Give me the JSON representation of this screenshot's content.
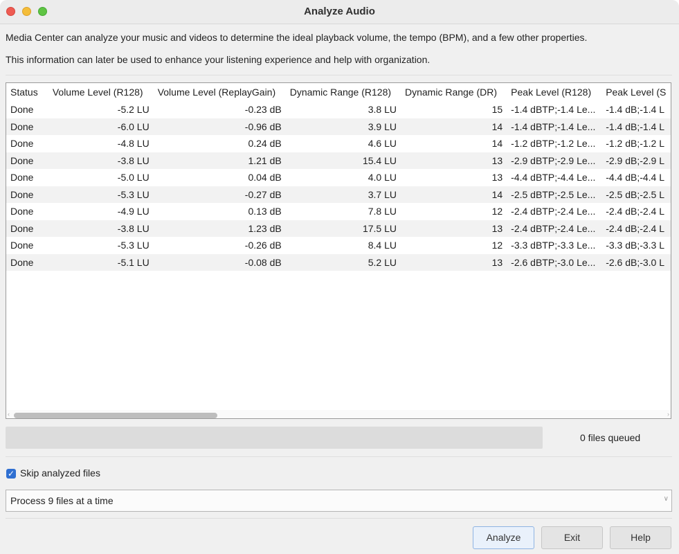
{
  "window": {
    "title": "Analyze Audio"
  },
  "description": {
    "line1": "Media Center can analyze your music and videos to determine the ideal playback volume, the tempo (BPM), and a few other properties.",
    "line2": "This information can later be used to enhance your listening experience and help with organization."
  },
  "table": {
    "columns": [
      "Status",
      "Volume Level (R128)",
      "Volume Level (ReplayGain)",
      "Dynamic Range (R128)",
      "Dynamic Range (DR)",
      "Peak Level (R128)",
      "Peak Level (S"
    ],
    "rows": [
      [
        "Done",
        "-5.2 LU",
        "-0.23 dB",
        "3.8 LU",
        "15",
        "-1.4 dBTP;-1.4 Le...",
        "-1.4 dB;-1.4 L"
      ],
      [
        "Done",
        "-6.0 LU",
        "-0.96 dB",
        "3.9 LU",
        "14",
        "-1.4 dBTP;-1.4 Le...",
        "-1.4 dB;-1.4 L"
      ],
      [
        "Done",
        "-4.8 LU",
        "0.24 dB",
        "4.6 LU",
        "14",
        "-1.2 dBTP;-1.2 Le...",
        "-1.2 dB;-1.2 L"
      ],
      [
        "Done",
        "-3.8 LU",
        "1.21 dB",
        "15.4 LU",
        "13",
        "-2.9 dBTP;-2.9 Le...",
        "-2.9 dB;-2.9 L"
      ],
      [
        "Done",
        "-5.0 LU",
        "0.04 dB",
        "4.0 LU",
        "13",
        "-4.4 dBTP;-4.4 Le...",
        "-4.4 dB;-4.4 L"
      ],
      [
        "Done",
        "-5.3 LU",
        "-0.27 dB",
        "3.7 LU",
        "14",
        "-2.5 dBTP;-2.5 Le...",
        "-2.5 dB;-2.5 L"
      ],
      [
        "Done",
        "-4.9 LU",
        "0.13 dB",
        "7.8 LU",
        "12",
        "-2.4 dBTP;-2.4 Le...",
        "-2.4 dB;-2.4 L"
      ],
      [
        "Done",
        "-3.8 LU",
        "1.23 dB",
        "17.5 LU",
        "13",
        "-2.4 dBTP;-2.4 Le...",
        "-2.4 dB;-2.4 L"
      ],
      [
        "Done",
        "-5.3 LU",
        "-0.26 dB",
        "8.4 LU",
        "12",
        "-3.3 dBTP;-3.3 Le...",
        "-3.3 dB;-3.3 L"
      ],
      [
        "Done",
        "-5.1 LU",
        "-0.08 dB",
        "5.2 LU",
        "13",
        "-2.6 dBTP;-3.0 Le...",
        "-2.6 dB;-3.0 L"
      ]
    ]
  },
  "progress": {
    "fraction": 0,
    "queued_label": "0 files queued"
  },
  "options": {
    "skip_label": "Skip analyzed files",
    "skip_checked": true,
    "check_glyph": "✓"
  },
  "combo": {
    "value": "Process 9 files at a time",
    "arrow": "∨"
  },
  "scroll": {
    "left_arrow": "‹",
    "right_arrow": "›"
  },
  "buttons": {
    "analyze": "Analyze",
    "exit": "Exit",
    "help": "Help"
  }
}
